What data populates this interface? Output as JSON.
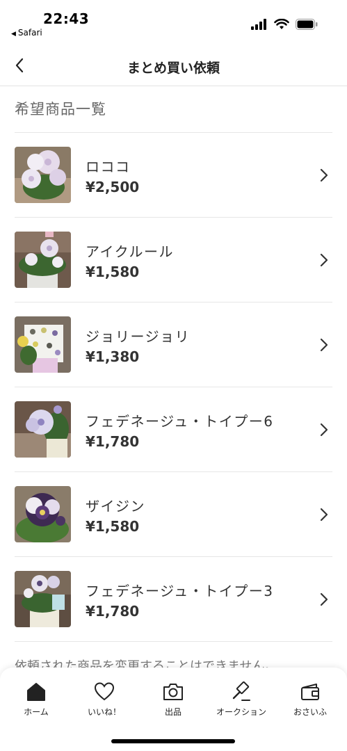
{
  "status_bar": {
    "time": "22:43",
    "back_app": "Safari"
  },
  "nav": {
    "title": "まとめ買い依頼"
  },
  "section": {
    "title": "希望商品一覧"
  },
  "products": [
    {
      "name": "ロココ",
      "price": "¥2,500"
    },
    {
      "name": "アイクルール",
      "price": "¥1,580"
    },
    {
      "name": "ジョリージョリ",
      "price": "¥1,380"
    },
    {
      "name": "フェデネージュ・トイプー6",
      "price": "¥1,780"
    },
    {
      "name": "ザイジン",
      "price": "¥1,580"
    },
    {
      "name": "フェデネージュ・トイプー3",
      "price": "¥1,780"
    }
  ],
  "notice": "依頼された商品を変更することはできません。",
  "tabs": [
    {
      "label": "ホーム",
      "icon": "home-icon",
      "active": true
    },
    {
      "label": "いいね！",
      "icon": "heart-icon",
      "active": false
    },
    {
      "label": "出品",
      "icon": "camera-icon",
      "active": false
    },
    {
      "label": "オークション",
      "icon": "gavel-icon",
      "active": false
    },
    {
      "label": "おさいふ",
      "icon": "wallet-icon",
      "active": false
    }
  ],
  "colors": {
    "text_primary": "#333333",
    "text_secondary": "#666666",
    "divider": "#e6e6e6"
  }
}
